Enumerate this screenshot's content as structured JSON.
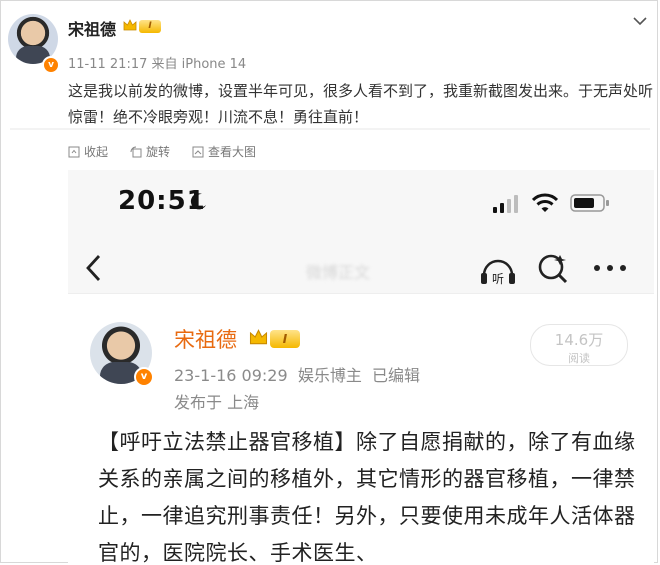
{
  "post": {
    "author": "宋祖德",
    "level": "I",
    "time": "11-11 21:17",
    "source": "来自 iPhone 14",
    "text": "这是我以前发的微博，设置半年可见，很多人看不到了，我重新截图发出来。于无声处听惊雷！绝不冷眼旁观！川流不息！勇往直前！",
    "actions": [
      {
        "label": "收起",
        "icon": "collapse-icon"
      },
      {
        "label": "旋转",
        "icon": "rotate-icon"
      },
      {
        "label": "查看大图",
        "icon": "view-large-icon"
      }
    ]
  },
  "screenshot": {
    "status_time": "20:51",
    "blurred_title": "微博正文",
    "card": {
      "author": "宋祖德",
      "level": "I",
      "date": "23-1-16 09:29",
      "role": "娱乐博主",
      "edited": "已编辑",
      "location": "发布于 上海",
      "reads_count": "14.6万",
      "reads_label": "阅读",
      "text": "【呼吁立法禁止器官移植】除了自愿捐献的，除了有血缘关系的亲属之间的移植外，其它情形的器官移植，一律禁止，一律追究刑事责任！另外，只要使用未成年人活体器官的，医院院长、手术医生、"
    }
  },
  "colors": {
    "accent_orange": "#e86a10",
    "verified_badge": "#ff8200",
    "level_gold": "#f5b800"
  }
}
